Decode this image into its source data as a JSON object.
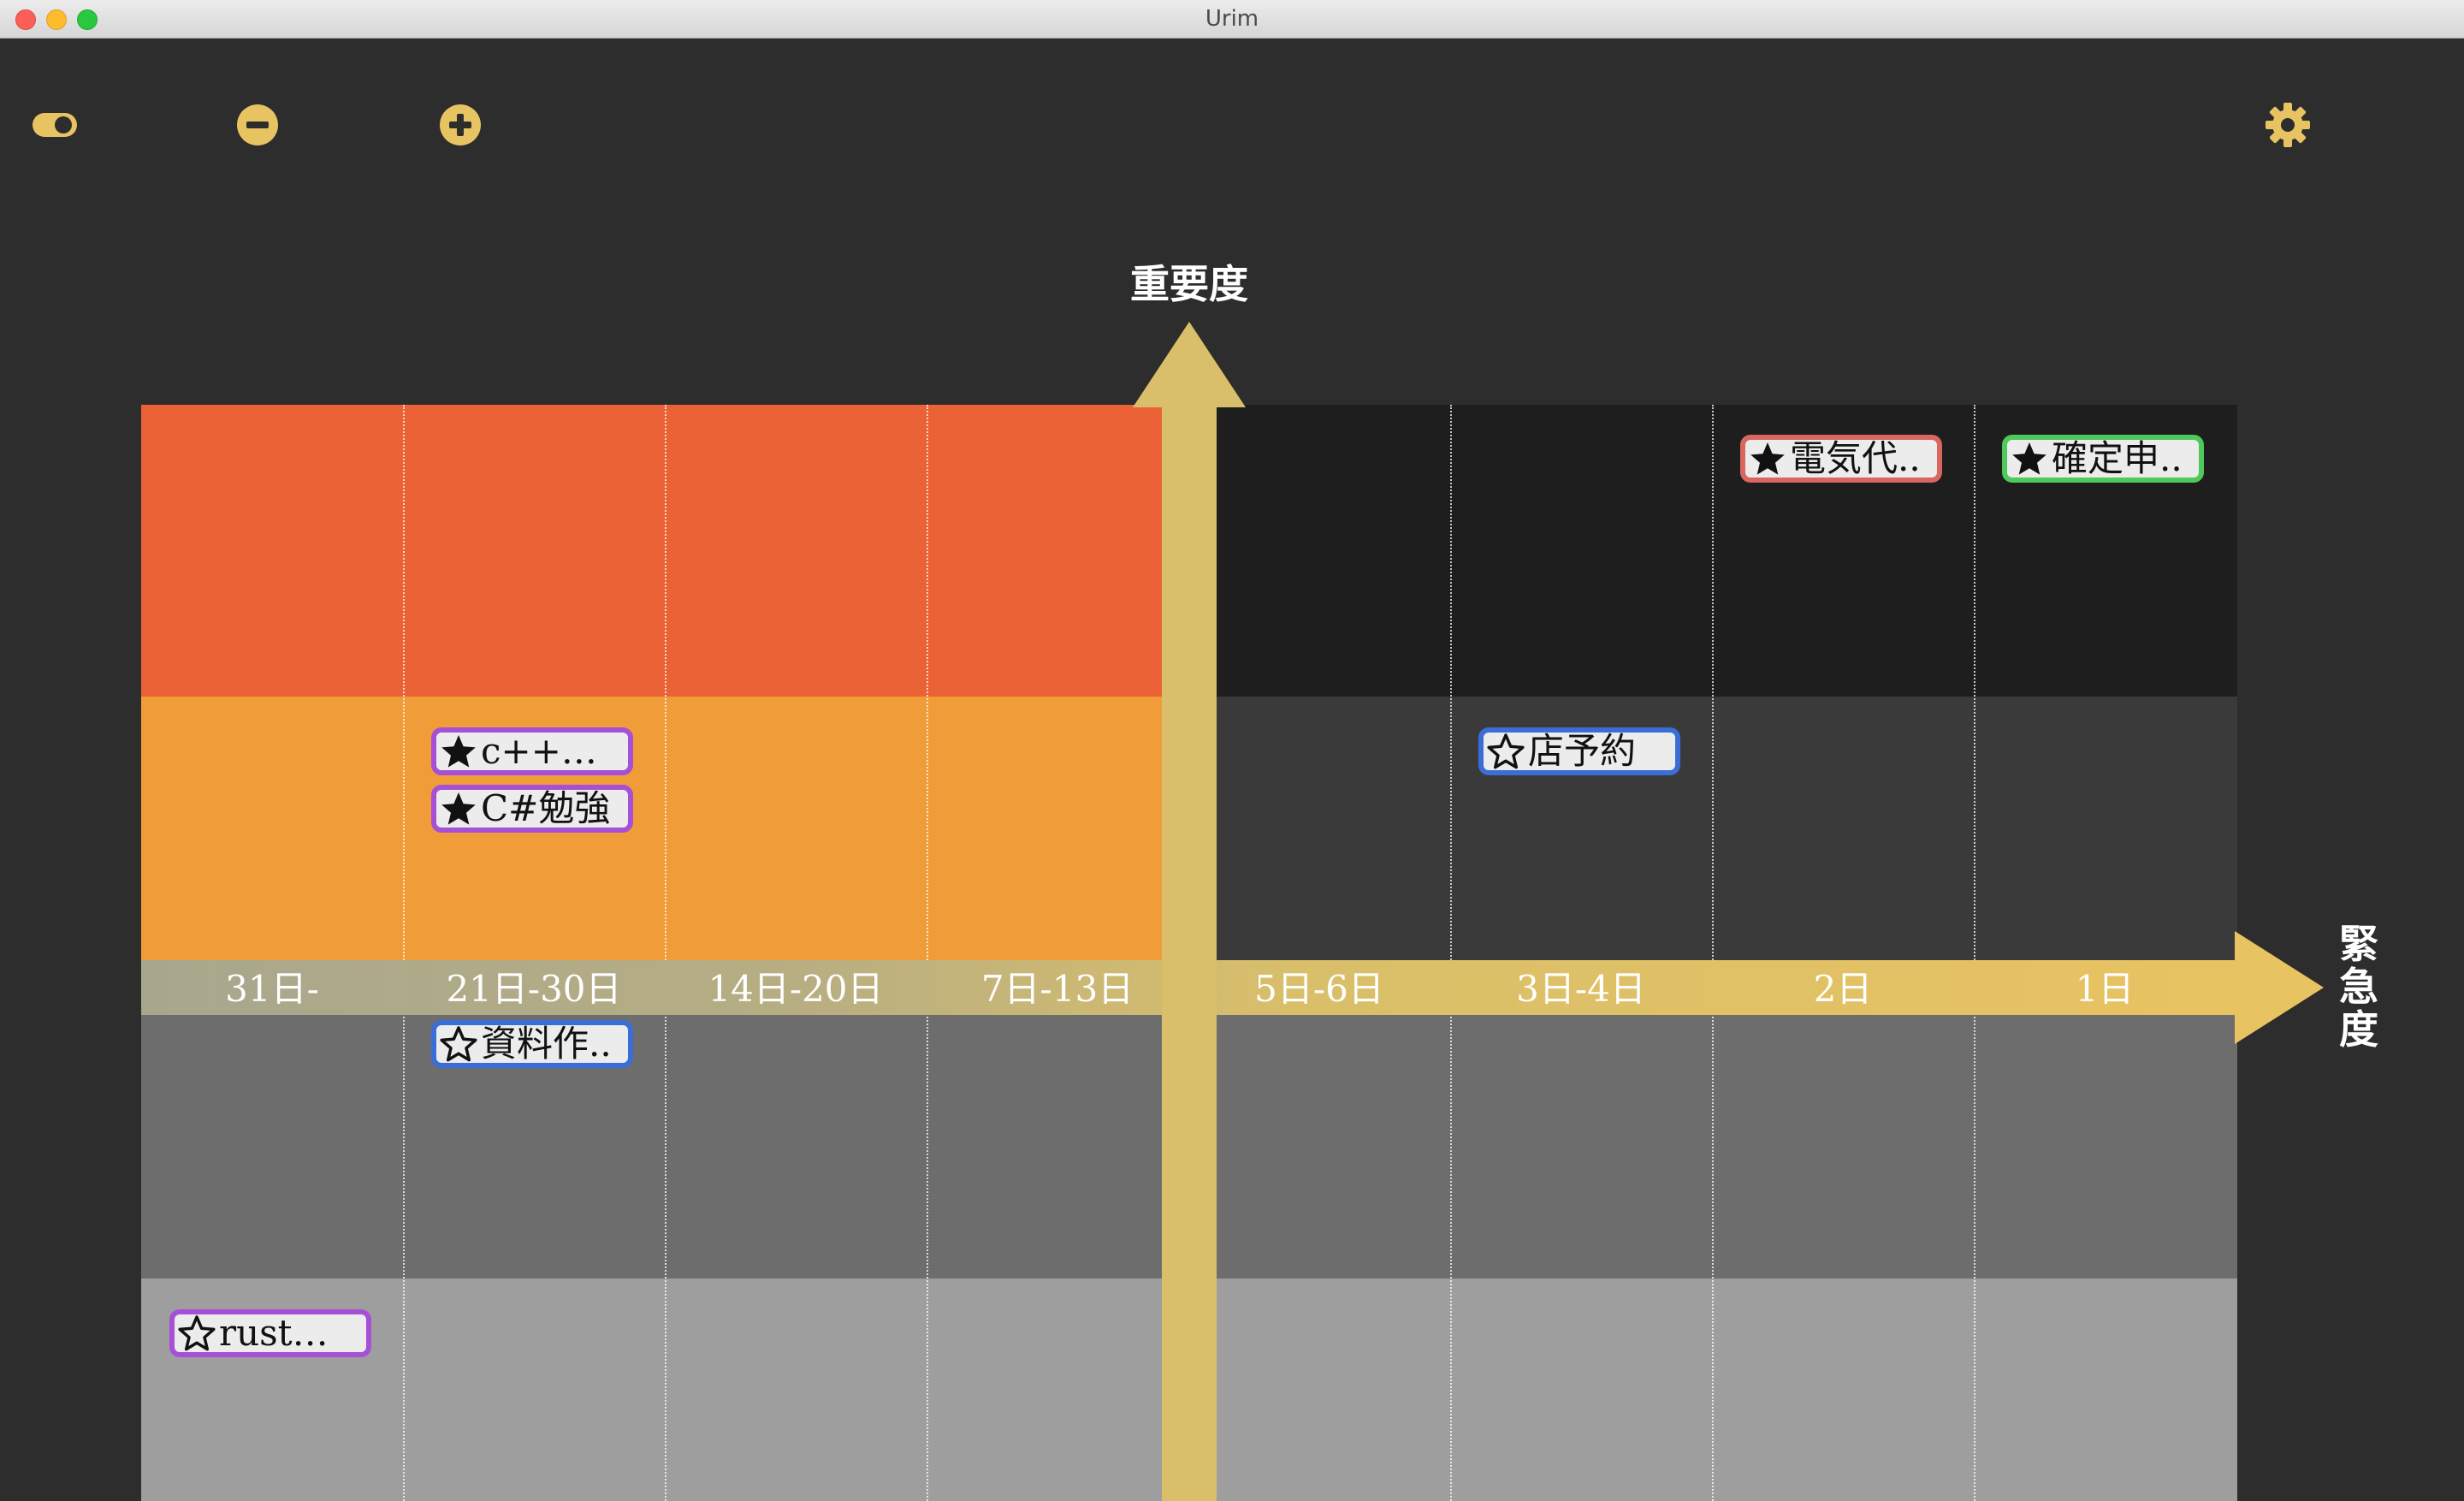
{
  "window": {
    "title": "Urim"
  },
  "toolbar": {
    "toggle_icon": "toggle-icon",
    "minus_icon": "minus-circle-icon",
    "plus_icon": "plus-circle-icon",
    "settings_icon": "gear-icon"
  },
  "axes": {
    "importance_label": "重要度",
    "urgency_label_chars": [
      "緊",
      "急",
      "度"
    ]
  },
  "columns": [
    "31日-",
    "21日-30日",
    "14日-20日",
    "7日-13日",
    "5日-6日",
    "3日-4日",
    "2日",
    "1日"
  ],
  "colors": {
    "accent": "#e8c362",
    "red_zone": "#ea6236",
    "orange_zone": "#f09c38",
    "dark_zone": "#1e1e1e",
    "dark_gray": "#3a3a3a",
    "mid_gray": "#6d6d6d",
    "light_gray": "#9e9e9e"
  },
  "tasks": [
    {
      "label": "電気代..",
      "starred": true,
      "border": "#d9665f"
    },
    {
      "label": "確定申..",
      "starred": true,
      "border": "#4fc95c"
    },
    {
      "label": "c++勉強",
      "starred": true,
      "border": "#a64fd7"
    },
    {
      "label": "C#勉強",
      "starred": true,
      "border": "#a64fd7"
    },
    {
      "label": "店予約",
      "starred": false,
      "border": "#3a6ed6"
    },
    {
      "label": "資料作..",
      "starred": false,
      "border": "#3a6ed6"
    },
    {
      "label": "rust勉強",
      "starred": false,
      "border": "#a64fd7"
    }
  ]
}
